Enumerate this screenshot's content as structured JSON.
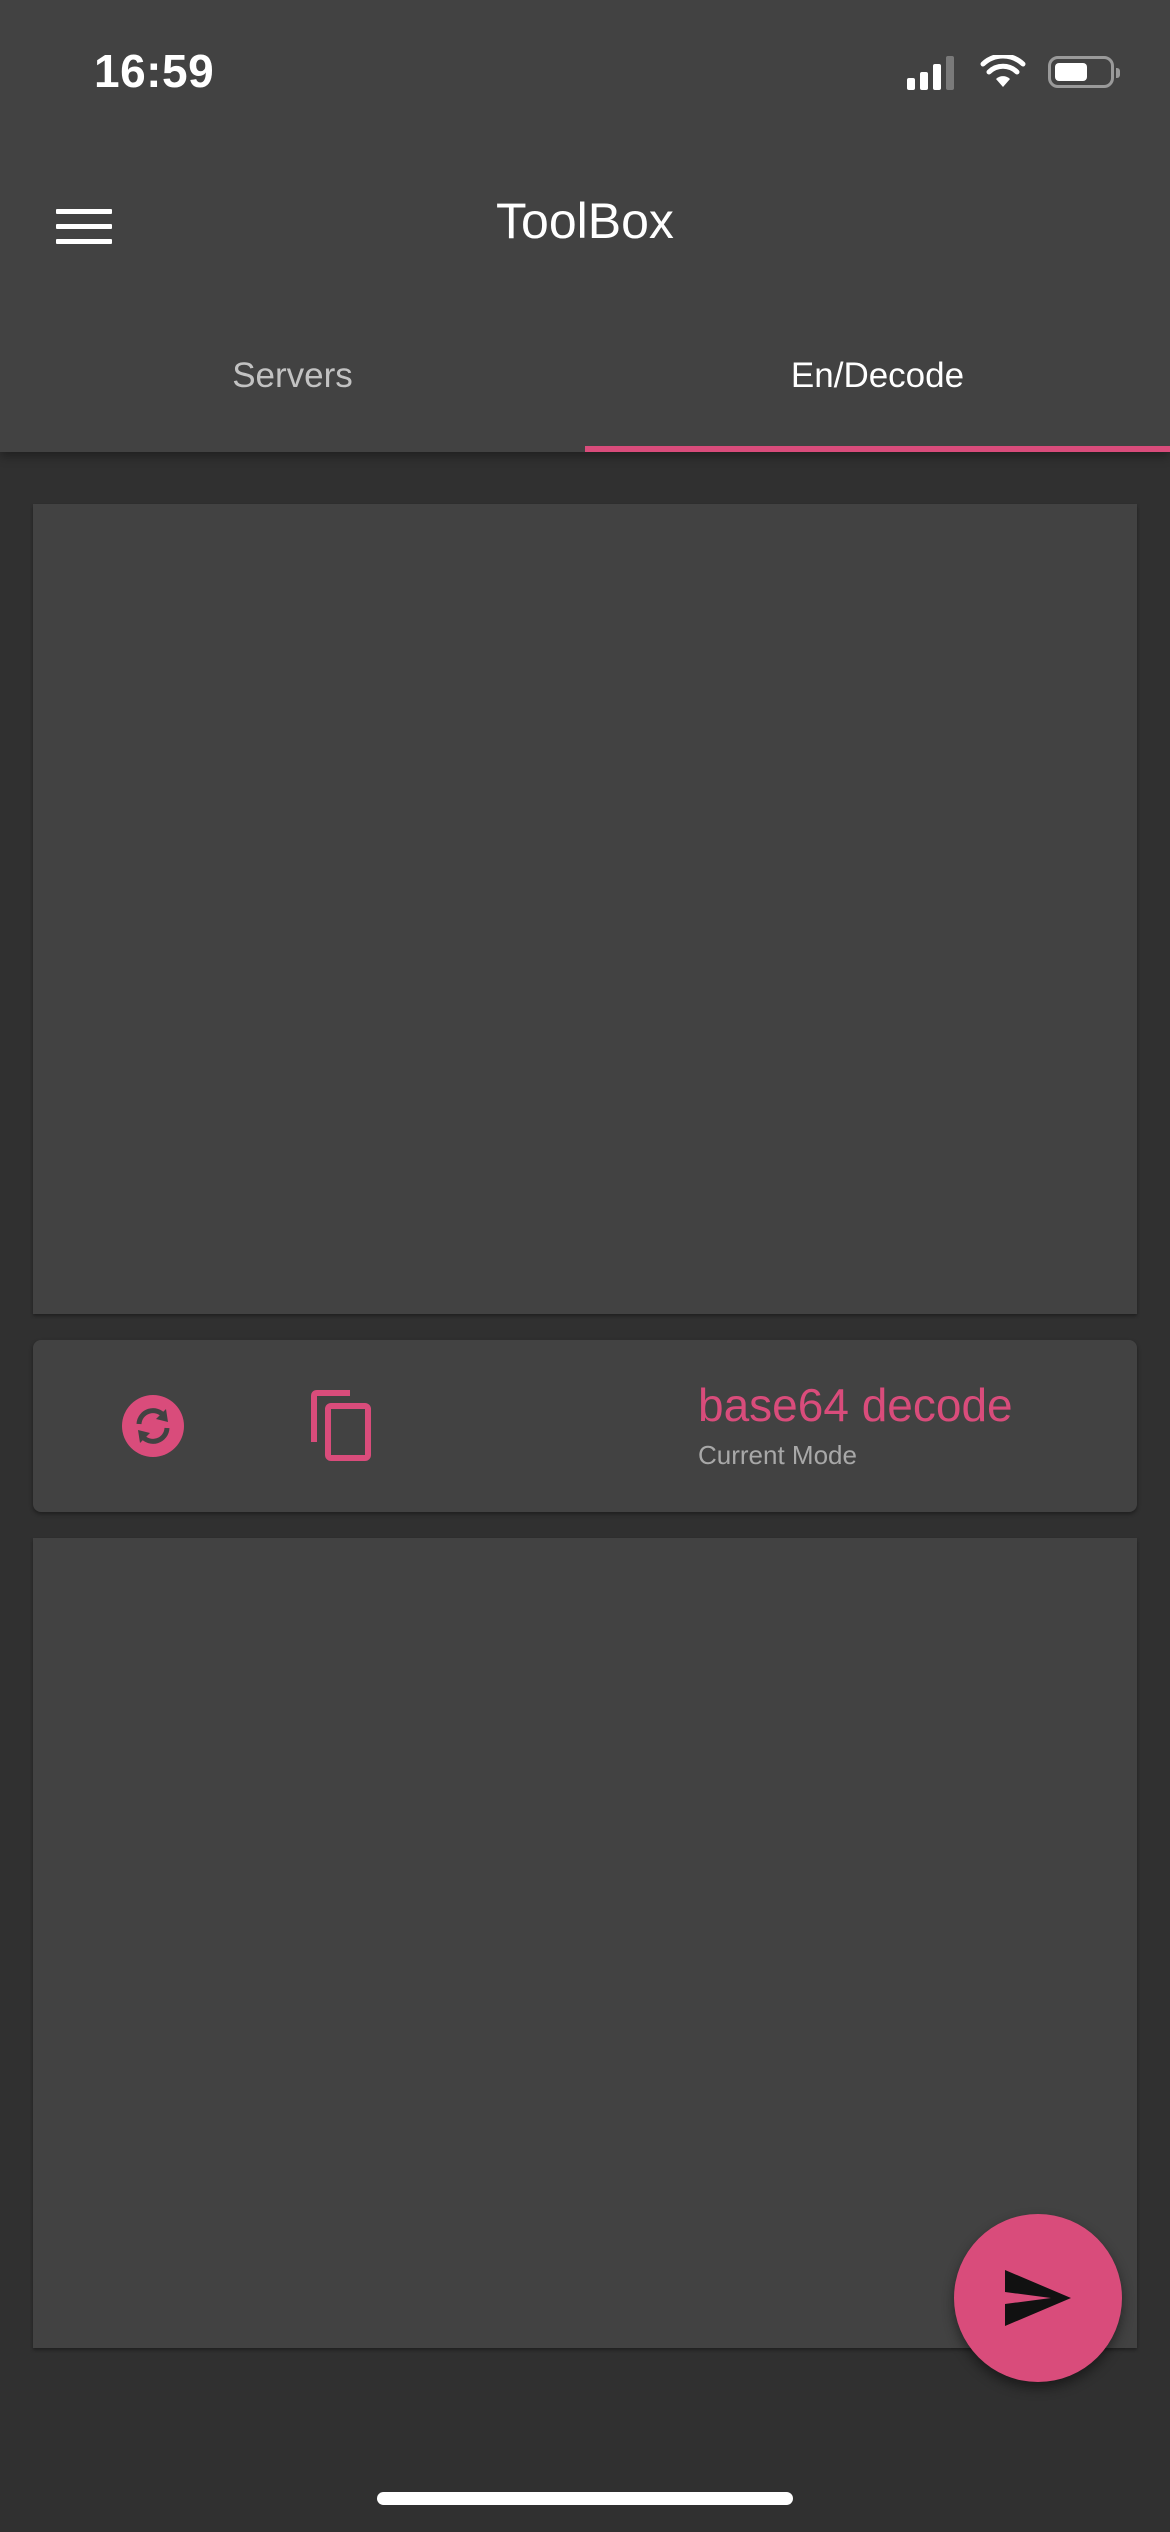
{
  "status_bar": {
    "time": "16:59",
    "icons": [
      "cellular-signal-icon",
      "wifi-icon",
      "battery-icon"
    ]
  },
  "app_bar": {
    "title": "ToolBox",
    "menu_icon": "menu-icon"
  },
  "tabs": [
    {
      "label": "Servers",
      "selected": false
    },
    {
      "label": "En/Decode",
      "selected": true
    }
  ],
  "input_panel": {
    "value": "",
    "placeholder": ""
  },
  "controls": {
    "swap_icon": "sync-icon",
    "copy_icon": "copy-icon",
    "mode_value": "base64 decode",
    "mode_caption": "Current Mode"
  },
  "output_panel": {
    "value": "",
    "placeholder": ""
  },
  "fab": {
    "icon": "send-icon"
  },
  "colors": {
    "accent": "#d94c7b",
    "surface": "#424242",
    "background": "#303030",
    "text_primary": "#ffffff",
    "text_secondary": "#a8a8a8"
  }
}
